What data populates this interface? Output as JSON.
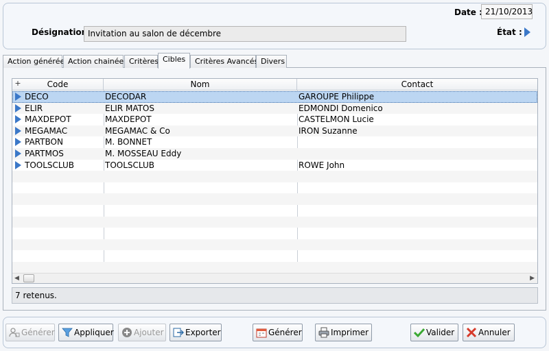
{
  "header": {
    "date_label": "Date :",
    "date_value": "21/10/2013",
    "designation_label": "Désignation :",
    "designation_value": "Invitation au salon de décembre",
    "etat_label": "État :"
  },
  "tabs": [
    {
      "label": "Action générée",
      "active": false
    },
    {
      "label": "Action chainée",
      "active": false
    },
    {
      "label": "Critères",
      "active": false
    },
    {
      "label": "Cibles",
      "active": true
    },
    {
      "label": "Critères Avancés",
      "active": false
    },
    {
      "label": "Divers",
      "active": false
    }
  ],
  "grid": {
    "plus": "+",
    "columns": [
      "Code",
      "Nom",
      "Contact"
    ],
    "rows": [
      {
        "code": "DECO",
        "nom": "DECODAR",
        "contact": "GAROUPE Philippe",
        "selected": true
      },
      {
        "code": "ELIR",
        "nom": "ELIR MATOS",
        "contact": "EDMONDI Domenico"
      },
      {
        "code": "MAXDEPOT",
        "nom": "MAXDEPOT",
        "contact": "CASTELMON Lucie"
      },
      {
        "code": "MEGAMAC",
        "nom": "MEGAMAC & Co",
        "contact": "IRON Suzanne"
      },
      {
        "code": "PARTBON",
        "nom": "M. BONNET",
        "contact": ""
      },
      {
        "code": "PARTMOS",
        "nom": "M. MOSSEAU Eddy",
        "contact": ""
      },
      {
        "code": "TOOLSCLUB",
        "nom": "TOOLSCLUB",
        "contact": "ROWE John"
      }
    ]
  },
  "status": "7 retenus.",
  "toolbar": {
    "generer1": "Générer",
    "appliquer": "Appliquer",
    "ajouter": "Ajouter",
    "exporter": "Exporter",
    "generer2": "Générer",
    "imprimer": "Imprimer",
    "valider": "Valider",
    "annuler": "Annuler"
  },
  "colors": {
    "accent": "#3b78c8",
    "selection": "#bcd6f2"
  }
}
